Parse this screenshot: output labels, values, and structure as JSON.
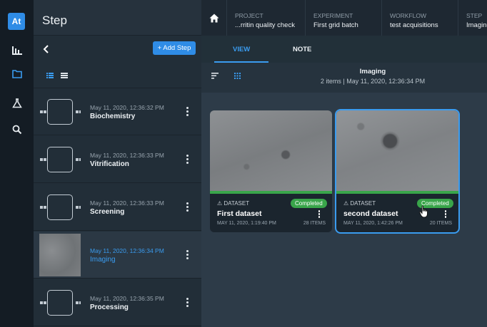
{
  "app": {
    "logo_text": "At"
  },
  "rail": {
    "items": [
      {
        "icon": "bar-chart-icon"
      },
      {
        "icon": "folder-icon"
      },
      {
        "icon": "flask-icon"
      },
      {
        "icon": "search-icon"
      }
    ]
  },
  "step_panel": {
    "title": "Step",
    "add_label": "+ Add Step",
    "steps": [
      {
        "date": "May 11, 2020, 12:36:32 PM",
        "name": "Biochemistry",
        "active": false
      },
      {
        "date": "May 11, 2020, 12:36:33 PM",
        "name": "Vitrification",
        "active": false
      },
      {
        "date": "May 11, 2020, 12:36:33 PM",
        "name": "Screening",
        "active": false
      },
      {
        "date": "May 11, 2020, 12:36:34 PM",
        "name": "Imaging",
        "active": true
      },
      {
        "date": "May 11, 2020, 12:36:35 PM",
        "name": "Processing",
        "active": false
      }
    ]
  },
  "breadcrumbs": [
    {
      "label": "PROJECT",
      "value": "...rritin quality check"
    },
    {
      "label": "EXPERIMENT",
      "value": "First grid batch"
    },
    {
      "label": "WORKFLOW",
      "value": "test acquisitions"
    },
    {
      "label": "STEP",
      "value": "Imaging"
    }
  ],
  "tabs": [
    {
      "label": "VIEW",
      "active": true
    },
    {
      "label": "NOTE",
      "active": false
    }
  ],
  "subbar": {
    "title": "Imaging",
    "meta": "2 items  |  May 11, 2020, 12:36:34 PM"
  },
  "datasets": [
    {
      "type": "DATASET",
      "status": "Completed",
      "name": "First dataset",
      "date": "MAY 11, 2020, 1:19:40 PM",
      "count": "28 ITEMS",
      "selected": false
    },
    {
      "type": "DATASET",
      "status": "Completed",
      "name": "second dataset",
      "date": "MAY 11, 2020, 1:42:26 PM",
      "count": "20 ITEMS",
      "selected": true
    }
  ],
  "colors": {
    "accent": "#2f8ce6",
    "active_text": "#3a9cf0",
    "status_completed": "#39a54a"
  }
}
